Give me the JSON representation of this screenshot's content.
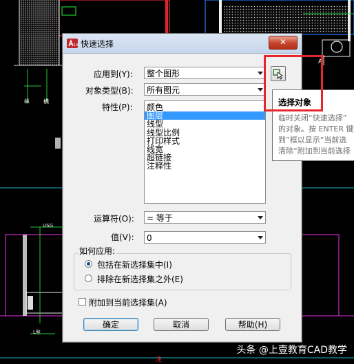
{
  "dialog": {
    "title": "快速选择",
    "close_label": "关闭",
    "apply_to": {
      "label": "应用到(Y):",
      "value": "整个图形"
    },
    "object_type": {
      "label": "对象类型(B):",
      "value": "所有图元"
    },
    "properties": {
      "label": "特性(P):",
      "items": [
        "颜色",
        "图层",
        "线型",
        "线型比例",
        "打印样式",
        "线宽",
        "超链接",
        "注释性"
      ],
      "selected": "图层"
    },
    "operator": {
      "label": "运算符(O):",
      "value": "= 等于"
    },
    "value": {
      "label": "值(V):",
      "value": "0"
    },
    "how_to_apply": {
      "title": "如何应用:",
      "include": "包括在新选择集中(I)",
      "exclude": "排除在新选择集之外(E)",
      "selected": "include"
    },
    "append": {
      "label": "附加到当前选择集(A)",
      "checked": false
    },
    "buttons": {
      "ok": "确定",
      "cancel": "取消",
      "help": "帮助(H)"
    }
  },
  "tooltip": {
    "title": "选择对象",
    "lines": [
      "临时关闭“快速选择”",
      "的对象。按 ENTER 键",
      "到”框以显示“当前选",
      "清除“附加到当前选择"
    ]
  },
  "watermark": "头条 @上壹教育CAD教学",
  "colors": {
    "highlight_box": "#e8262a",
    "selection": "#3399ff"
  }
}
